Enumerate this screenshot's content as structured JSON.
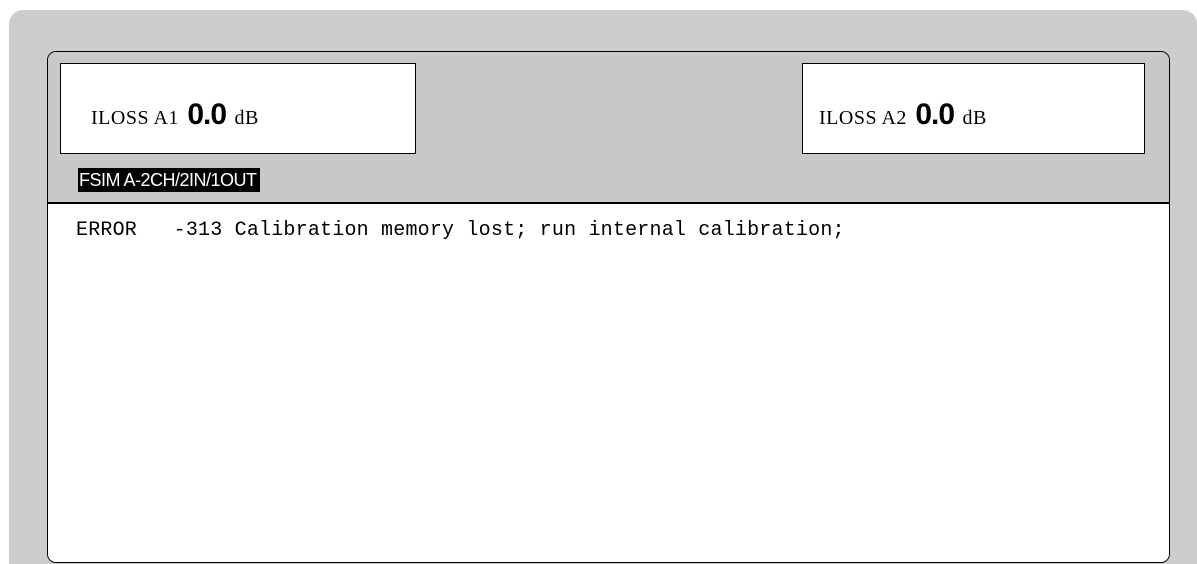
{
  "panel_a1": {
    "label": "ILOSS A1",
    "value": "0.0",
    "unit": "dB"
  },
  "panel_a2": {
    "label": "ILOSS A2",
    "value": "0.0",
    "unit": "dB"
  },
  "mode": "FSIM A-2CH/2IN/1OUT",
  "message": {
    "text": "ERROR   -313 Calibration memory lost; run internal calibration;"
  },
  "colors": {
    "frame": "#cdcdcd",
    "header_bg": "#c8c8c8",
    "field_bg": "#ffffff",
    "mode_label_bg": "#000000",
    "mode_label_fg": "#ffffff"
  }
}
